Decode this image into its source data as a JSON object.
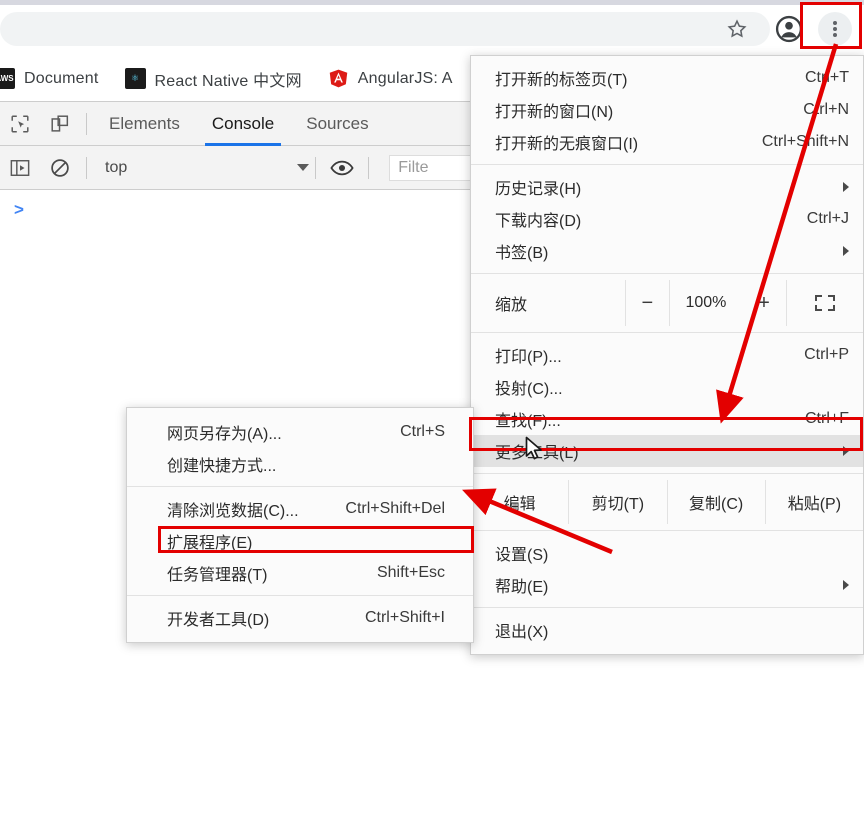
{
  "browser": {
    "toolbar": {
      "star_icon": "star-icon",
      "avatar_icon": "profile-avatar-icon",
      "menu_icon": "three-dot-menu-icon"
    },
    "bookmarks": [
      {
        "label": "Document",
        "favicon": "aws-favicon",
        "fav_text": "AWS"
      },
      {
        "label": "React Native 中文网",
        "favicon": "react-favicon",
        "fav_text": "⚛"
      },
      {
        "label": "AngularJS: A",
        "favicon": "angularjs-favicon",
        "fav_text": "A"
      }
    ]
  },
  "devtools": {
    "tools": {
      "inspect_icon": "inspect-element-icon",
      "device_icon": "toggle-device-toolbar-icon",
      "sidebar_icon": "toggle-console-sidebar-icon",
      "clear_icon": "clear-console-icon",
      "eye_icon": "live-expression-eye-icon"
    },
    "tabs": [
      {
        "label": "Elements",
        "active": false
      },
      {
        "label": "Console",
        "active": true
      },
      {
        "label": "Sources",
        "active": false
      }
    ],
    "context": "top",
    "filter_placeholder": "Filte",
    "prompt": ">"
  },
  "chrome_menu": {
    "groups": [
      {
        "items": [
          {
            "label": "打开新的标签页(T)",
            "accel": "Ctrl+T"
          },
          {
            "label": "打开新的窗口(N)",
            "accel": "Ctrl+N"
          },
          {
            "label": "打开新的无痕窗口(I)",
            "accel": "Ctrl+Shift+N"
          }
        ]
      },
      {
        "items": [
          {
            "label": "历史记录(H)",
            "accel": "",
            "submenu": true
          },
          {
            "label": "下载内容(D)",
            "accel": "Ctrl+J"
          },
          {
            "label": "书签(B)",
            "accel": "",
            "submenu": true
          }
        ]
      }
    ],
    "zoom": {
      "label": "缩放",
      "minus": "−",
      "value": "100%",
      "plus": "+",
      "fullscreen_icon": "fullscreen-icon"
    },
    "group3": [
      {
        "label": "打印(P)...",
        "accel": "Ctrl+P"
      },
      {
        "label": "投射(C)...",
        "accel": ""
      },
      {
        "label": "查找(F)...",
        "accel": "Ctrl+F"
      },
      {
        "label": "更多工具(L)",
        "accel": "",
        "submenu": true,
        "highlighted": true
      }
    ],
    "edit_row": {
      "label": "编辑",
      "cut": "剪切(T)",
      "copy": "复制(C)",
      "paste": "粘贴(P)"
    },
    "group4": [
      {
        "label": "设置(S)",
        "accel": ""
      },
      {
        "label": "帮助(E)",
        "accel": "",
        "submenu": true
      }
    ],
    "group5": [
      {
        "label": "退出(X)",
        "accel": ""
      }
    ]
  },
  "tools_submenu": {
    "groups": [
      {
        "items": [
          {
            "label": "网页另存为(A)...",
            "accel": "Ctrl+S"
          },
          {
            "label": "创建快捷方式...",
            "accel": ""
          }
        ]
      },
      {
        "items": [
          {
            "label": "清除浏览数据(C)...",
            "accel": "Ctrl+Shift+Del"
          },
          {
            "label": "扩展程序(E)",
            "accel": "",
            "highlighted": true
          },
          {
            "label": "任务管理器(T)",
            "accel": "Shift+Esc"
          }
        ]
      },
      {
        "items": [
          {
            "label": "开发者工具(D)",
            "accel": "Ctrl+Shift+I"
          }
        ]
      }
    ]
  },
  "annotations": {
    "highlight_color": "#e30000",
    "boxes": [
      {
        "name": "three-dot-menu-highlight"
      },
      {
        "name": "more-tools-highlight"
      },
      {
        "name": "extensions-highlight"
      }
    ],
    "arrows": [
      {
        "name": "arrow-menu-to-more-tools"
      },
      {
        "name": "arrow-more-tools-to-extensions"
      }
    ],
    "cursor": "mouse-pointer-cursor"
  }
}
